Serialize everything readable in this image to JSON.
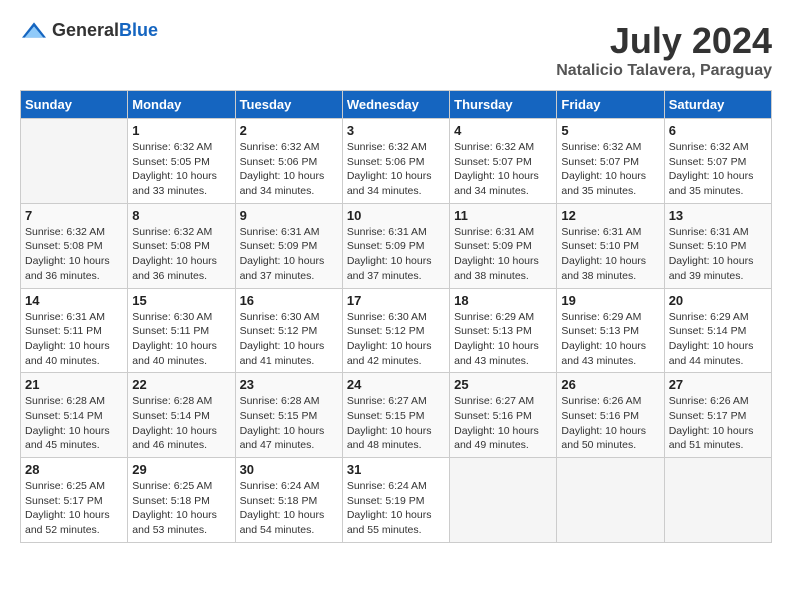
{
  "header": {
    "logo_general": "General",
    "logo_blue": "Blue",
    "month_year": "July 2024",
    "location": "Natalicio Talavera, Paraguay"
  },
  "weekdays": [
    "Sunday",
    "Monday",
    "Tuesday",
    "Wednesday",
    "Thursday",
    "Friday",
    "Saturday"
  ],
  "weeks": [
    [
      {
        "day": "",
        "sunrise": "",
        "sunset": "",
        "daylight": ""
      },
      {
        "day": "1",
        "sunrise": "Sunrise: 6:32 AM",
        "sunset": "Sunset: 5:05 PM",
        "daylight": "Daylight: 10 hours and 33 minutes."
      },
      {
        "day": "2",
        "sunrise": "Sunrise: 6:32 AM",
        "sunset": "Sunset: 5:06 PM",
        "daylight": "Daylight: 10 hours and 34 minutes."
      },
      {
        "day": "3",
        "sunrise": "Sunrise: 6:32 AM",
        "sunset": "Sunset: 5:06 PM",
        "daylight": "Daylight: 10 hours and 34 minutes."
      },
      {
        "day": "4",
        "sunrise": "Sunrise: 6:32 AM",
        "sunset": "Sunset: 5:07 PM",
        "daylight": "Daylight: 10 hours and 34 minutes."
      },
      {
        "day": "5",
        "sunrise": "Sunrise: 6:32 AM",
        "sunset": "Sunset: 5:07 PM",
        "daylight": "Daylight: 10 hours and 35 minutes."
      },
      {
        "day": "6",
        "sunrise": "Sunrise: 6:32 AM",
        "sunset": "Sunset: 5:07 PM",
        "daylight": "Daylight: 10 hours and 35 minutes."
      }
    ],
    [
      {
        "day": "7",
        "sunrise": "Sunrise: 6:32 AM",
        "sunset": "Sunset: 5:08 PM",
        "daylight": "Daylight: 10 hours and 36 minutes."
      },
      {
        "day": "8",
        "sunrise": "Sunrise: 6:32 AM",
        "sunset": "Sunset: 5:08 PM",
        "daylight": "Daylight: 10 hours and 36 minutes."
      },
      {
        "day": "9",
        "sunrise": "Sunrise: 6:31 AM",
        "sunset": "Sunset: 5:09 PM",
        "daylight": "Daylight: 10 hours and 37 minutes."
      },
      {
        "day": "10",
        "sunrise": "Sunrise: 6:31 AM",
        "sunset": "Sunset: 5:09 PM",
        "daylight": "Daylight: 10 hours and 37 minutes."
      },
      {
        "day": "11",
        "sunrise": "Sunrise: 6:31 AM",
        "sunset": "Sunset: 5:09 PM",
        "daylight": "Daylight: 10 hours and 38 minutes."
      },
      {
        "day": "12",
        "sunrise": "Sunrise: 6:31 AM",
        "sunset": "Sunset: 5:10 PM",
        "daylight": "Daylight: 10 hours and 38 minutes."
      },
      {
        "day": "13",
        "sunrise": "Sunrise: 6:31 AM",
        "sunset": "Sunset: 5:10 PM",
        "daylight": "Daylight: 10 hours and 39 minutes."
      }
    ],
    [
      {
        "day": "14",
        "sunrise": "Sunrise: 6:31 AM",
        "sunset": "Sunset: 5:11 PM",
        "daylight": "Daylight: 10 hours and 40 minutes."
      },
      {
        "day": "15",
        "sunrise": "Sunrise: 6:30 AM",
        "sunset": "Sunset: 5:11 PM",
        "daylight": "Daylight: 10 hours and 40 minutes."
      },
      {
        "day": "16",
        "sunrise": "Sunrise: 6:30 AM",
        "sunset": "Sunset: 5:12 PM",
        "daylight": "Daylight: 10 hours and 41 minutes."
      },
      {
        "day": "17",
        "sunrise": "Sunrise: 6:30 AM",
        "sunset": "Sunset: 5:12 PM",
        "daylight": "Daylight: 10 hours and 42 minutes."
      },
      {
        "day": "18",
        "sunrise": "Sunrise: 6:29 AM",
        "sunset": "Sunset: 5:13 PM",
        "daylight": "Daylight: 10 hours and 43 minutes."
      },
      {
        "day": "19",
        "sunrise": "Sunrise: 6:29 AM",
        "sunset": "Sunset: 5:13 PM",
        "daylight": "Daylight: 10 hours and 43 minutes."
      },
      {
        "day": "20",
        "sunrise": "Sunrise: 6:29 AM",
        "sunset": "Sunset: 5:14 PM",
        "daylight": "Daylight: 10 hours and 44 minutes."
      }
    ],
    [
      {
        "day": "21",
        "sunrise": "Sunrise: 6:28 AM",
        "sunset": "Sunset: 5:14 PM",
        "daylight": "Daylight: 10 hours and 45 minutes."
      },
      {
        "day": "22",
        "sunrise": "Sunrise: 6:28 AM",
        "sunset": "Sunset: 5:14 PM",
        "daylight": "Daylight: 10 hours and 46 minutes."
      },
      {
        "day": "23",
        "sunrise": "Sunrise: 6:28 AM",
        "sunset": "Sunset: 5:15 PM",
        "daylight": "Daylight: 10 hours and 47 minutes."
      },
      {
        "day": "24",
        "sunrise": "Sunrise: 6:27 AM",
        "sunset": "Sunset: 5:15 PM",
        "daylight": "Daylight: 10 hours and 48 minutes."
      },
      {
        "day": "25",
        "sunrise": "Sunrise: 6:27 AM",
        "sunset": "Sunset: 5:16 PM",
        "daylight": "Daylight: 10 hours and 49 minutes."
      },
      {
        "day": "26",
        "sunrise": "Sunrise: 6:26 AM",
        "sunset": "Sunset: 5:16 PM",
        "daylight": "Daylight: 10 hours and 50 minutes."
      },
      {
        "day": "27",
        "sunrise": "Sunrise: 6:26 AM",
        "sunset": "Sunset: 5:17 PM",
        "daylight": "Daylight: 10 hours and 51 minutes."
      }
    ],
    [
      {
        "day": "28",
        "sunrise": "Sunrise: 6:25 AM",
        "sunset": "Sunset: 5:17 PM",
        "daylight": "Daylight: 10 hours and 52 minutes."
      },
      {
        "day": "29",
        "sunrise": "Sunrise: 6:25 AM",
        "sunset": "Sunset: 5:18 PM",
        "daylight": "Daylight: 10 hours and 53 minutes."
      },
      {
        "day": "30",
        "sunrise": "Sunrise: 6:24 AM",
        "sunset": "Sunset: 5:18 PM",
        "daylight": "Daylight: 10 hours and 54 minutes."
      },
      {
        "day": "31",
        "sunrise": "Sunrise: 6:24 AM",
        "sunset": "Sunset: 5:19 PM",
        "daylight": "Daylight: 10 hours and 55 minutes."
      },
      {
        "day": "",
        "sunrise": "",
        "sunset": "",
        "daylight": ""
      },
      {
        "day": "",
        "sunrise": "",
        "sunset": "",
        "daylight": ""
      },
      {
        "day": "",
        "sunrise": "",
        "sunset": "",
        "daylight": ""
      }
    ]
  ]
}
